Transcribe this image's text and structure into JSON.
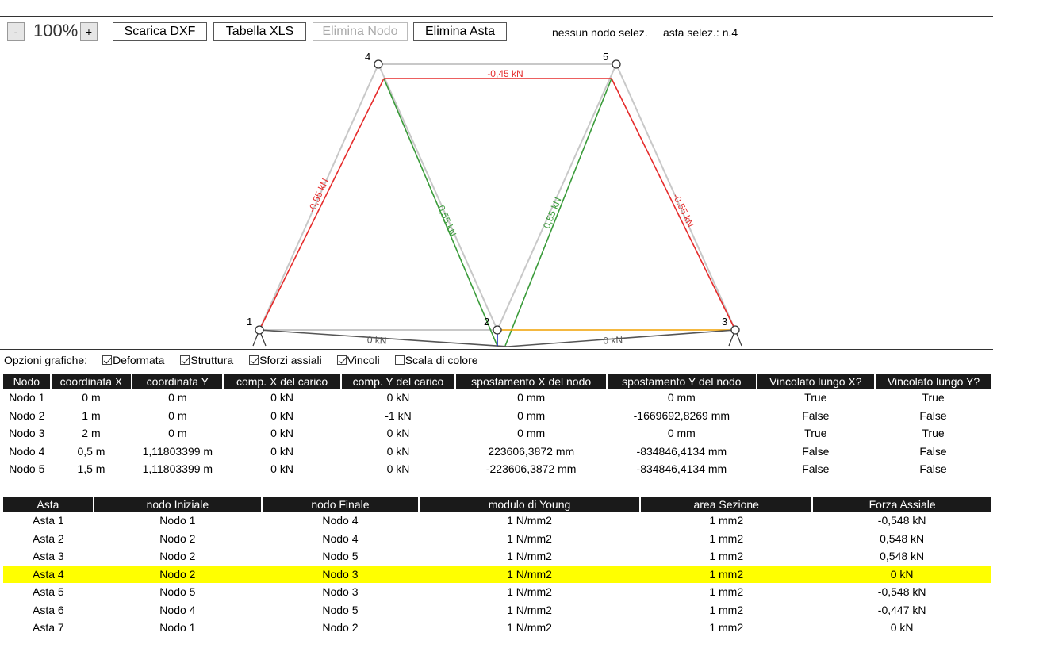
{
  "toolbar": {
    "zoom_out": "-",
    "zoom_level": "100%",
    "zoom_in": "+",
    "download_dxf": "Scarica DXF",
    "xls_table": "Tabella XLS",
    "delete_node": "Elimina Nodo",
    "delete_bar": "Elimina Asta",
    "node_status": "nessun nodo selez.",
    "bar_status": "asta selez.: n.4"
  },
  "drawing": {
    "node_labels": [
      "1",
      "2",
      "3",
      "4",
      "5"
    ],
    "force_labels": {
      "bar1": "-0,55 kN",
      "bar2": "0,55 kN",
      "bar3": "0,55 kN",
      "bar4": "0 kN",
      "bar5": "-0,55 kN",
      "bar6": "-0,45 kN",
      "bar7": "0 kN"
    },
    "colors": {
      "compression": "#e52b2b",
      "tension": "#3a9b3a",
      "zero_selected": "#f0a000",
      "zero": "#555555",
      "structure": "#c8c8c8",
      "load": "#1020c0"
    }
  },
  "options": {
    "label": "Opzioni grafiche:",
    "items": [
      {
        "label": "Deformata",
        "checked": true
      },
      {
        "label": "Struttura",
        "checked": true
      },
      {
        "label": "Sforzi assiali",
        "checked": true
      },
      {
        "label": "Vincoli",
        "checked": true
      },
      {
        "label": "Scala di colore",
        "checked": false
      }
    ]
  },
  "nodes_table": {
    "headers": [
      "Nodo",
      "coordinata X",
      "coordinata Y",
      "comp. X del carico",
      "comp. Y del carico",
      "spostamento X del nodo",
      "spostamento Y del nodo",
      "Vincolato lungo X?",
      "Vincolato lungo Y?"
    ],
    "rows": [
      [
        "Nodo 1",
        "0 m",
        "0 m",
        "0 kN",
        "0 kN",
        "0 mm",
        "0 mm",
        "True",
        "True"
      ],
      [
        "Nodo 2",
        "1 m",
        "0 m",
        "0 kN",
        "-1 kN",
        "0 mm",
        "-1669692,8269 mm",
        "False",
        "False"
      ],
      [
        "Nodo 3",
        "2 m",
        "0 m",
        "0 kN",
        "0 kN",
        "0 mm",
        "0 mm",
        "True",
        "True"
      ],
      [
        "Nodo 4",
        "0,5 m",
        "1,11803399 m",
        "0 kN",
        "0 kN",
        "223606,3872 mm",
        "-834846,4134 mm",
        "False",
        "False"
      ],
      [
        "Nodo 5",
        "1,5 m",
        "1,11803399 m",
        "0 kN",
        "0 kN",
        "-223606,3872 mm",
        "-834846,4134 mm",
        "False",
        "False"
      ]
    ]
  },
  "bars_table": {
    "headers": [
      "Asta",
      "nodo Iniziale",
      "nodo Finale",
      "modulo di Young",
      "area Sezione",
      "Forza Assiale"
    ],
    "selected_row": 3,
    "rows": [
      [
        "Asta 1",
        "Nodo 1",
        "Nodo 4",
        "1 N/mm2",
        "1 mm2",
        "-0,548 kN"
      ],
      [
        "Asta 2",
        "Nodo 2",
        "Nodo 4",
        "1 N/mm2",
        "1 mm2",
        "0,548 kN"
      ],
      [
        "Asta 3",
        "Nodo 2",
        "Nodo 5",
        "1 N/mm2",
        "1 mm2",
        "0,548 kN"
      ],
      [
        "Asta 4",
        "Nodo 2",
        "Nodo 3",
        "1 N/mm2",
        "1 mm2",
        "0 kN"
      ],
      [
        "Asta 5",
        "Nodo 5",
        "Nodo 3",
        "1 N/mm2",
        "1 mm2",
        "-0,548 kN"
      ],
      [
        "Asta 6",
        "Nodo 4",
        "Nodo 5",
        "1 N/mm2",
        "1 mm2",
        "-0,447 kN"
      ],
      [
        "Asta 7",
        "Nodo 1",
        "Nodo 2",
        "1 N/mm2",
        "1 mm2",
        "0 kN"
      ]
    ]
  }
}
